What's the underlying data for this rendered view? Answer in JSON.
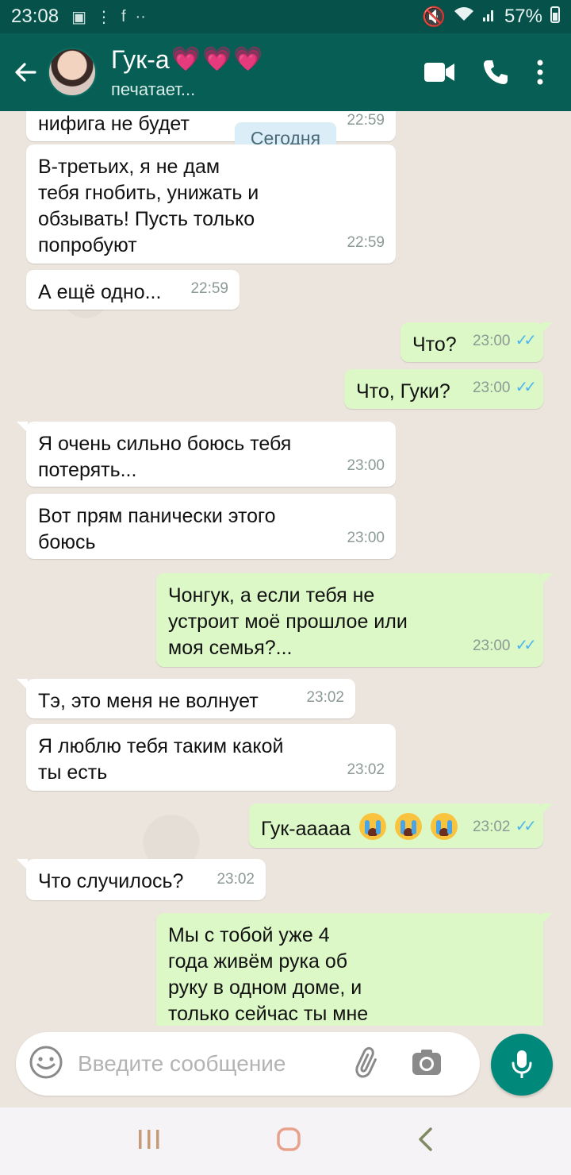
{
  "status_bar": {
    "time": "23:08",
    "battery": "57%"
  },
  "header": {
    "contact_name": "Гук-а",
    "hearts_count": 3,
    "status": "печатает..."
  },
  "chat": {
    "date_chip": "Сегодня",
    "messages": [
      {
        "dir": "in",
        "text": "нифига не будет",
        "time": "22:59"
      },
      {
        "dir": "in",
        "text": "В-третьих, я не дам\nтебя гнобить, унижать и\nобзывать! Пусть только\nпопробуют",
        "time": "22:59"
      },
      {
        "dir": "in",
        "text": "А ещё одно...",
        "time": "22:59"
      },
      {
        "dir": "out",
        "text": "Что?",
        "time": "23:00"
      },
      {
        "dir": "out",
        "text": "Что, Гуки?",
        "time": "23:00"
      },
      {
        "dir": "in",
        "text": "Я очень сильно боюсь тебя\nпотерять...",
        "time": "23:00"
      },
      {
        "dir": "in",
        "text": "Вот прям панически этого\nбоюсь",
        "time": "23:00"
      },
      {
        "dir": "out",
        "text": "Чонгук, а если тебя не\nустроит моё прошлое или\nмоя семья?...",
        "time": "23:00"
      },
      {
        "dir": "in",
        "text": "Тэ, это меня не волнует",
        "time": "23:02"
      },
      {
        "dir": "in",
        "text": "Я люблю тебя таким какой\nты есть",
        "time": "23:02"
      },
      {
        "dir": "out",
        "text": "Гук-ааааа",
        "time": "23:02",
        "emoji": "crying-face",
        "emoji_count": 3
      },
      {
        "dir": "in",
        "text": "Что случилось?",
        "time": "23:02"
      },
      {
        "dir": "out",
        "text": "Мы с тобой уже 4\nгода живём рука об\nруку в одном доме, и\nтолько сейчас ты мне",
        "time": ""
      }
    ]
  },
  "composer": {
    "placeholder": "Введите сообщение"
  },
  "icons": {
    "back": "arrow-left-icon",
    "video": "video-call-icon",
    "call": "phone-icon",
    "menu": "more-vert-icon",
    "emoji": "emoji-icon",
    "attach": "paperclip-icon",
    "camera": "camera-icon",
    "mic": "mic-icon",
    "read_receipt": "double-check-icon"
  },
  "colors": {
    "header": "#075e54",
    "outgoing_bubble": "#dcf8c6",
    "incoming_bubble": "#ffffff",
    "chat_background": "#ece5dd",
    "read_tick": "#4fb6ec",
    "mic_button": "#00897b"
  }
}
